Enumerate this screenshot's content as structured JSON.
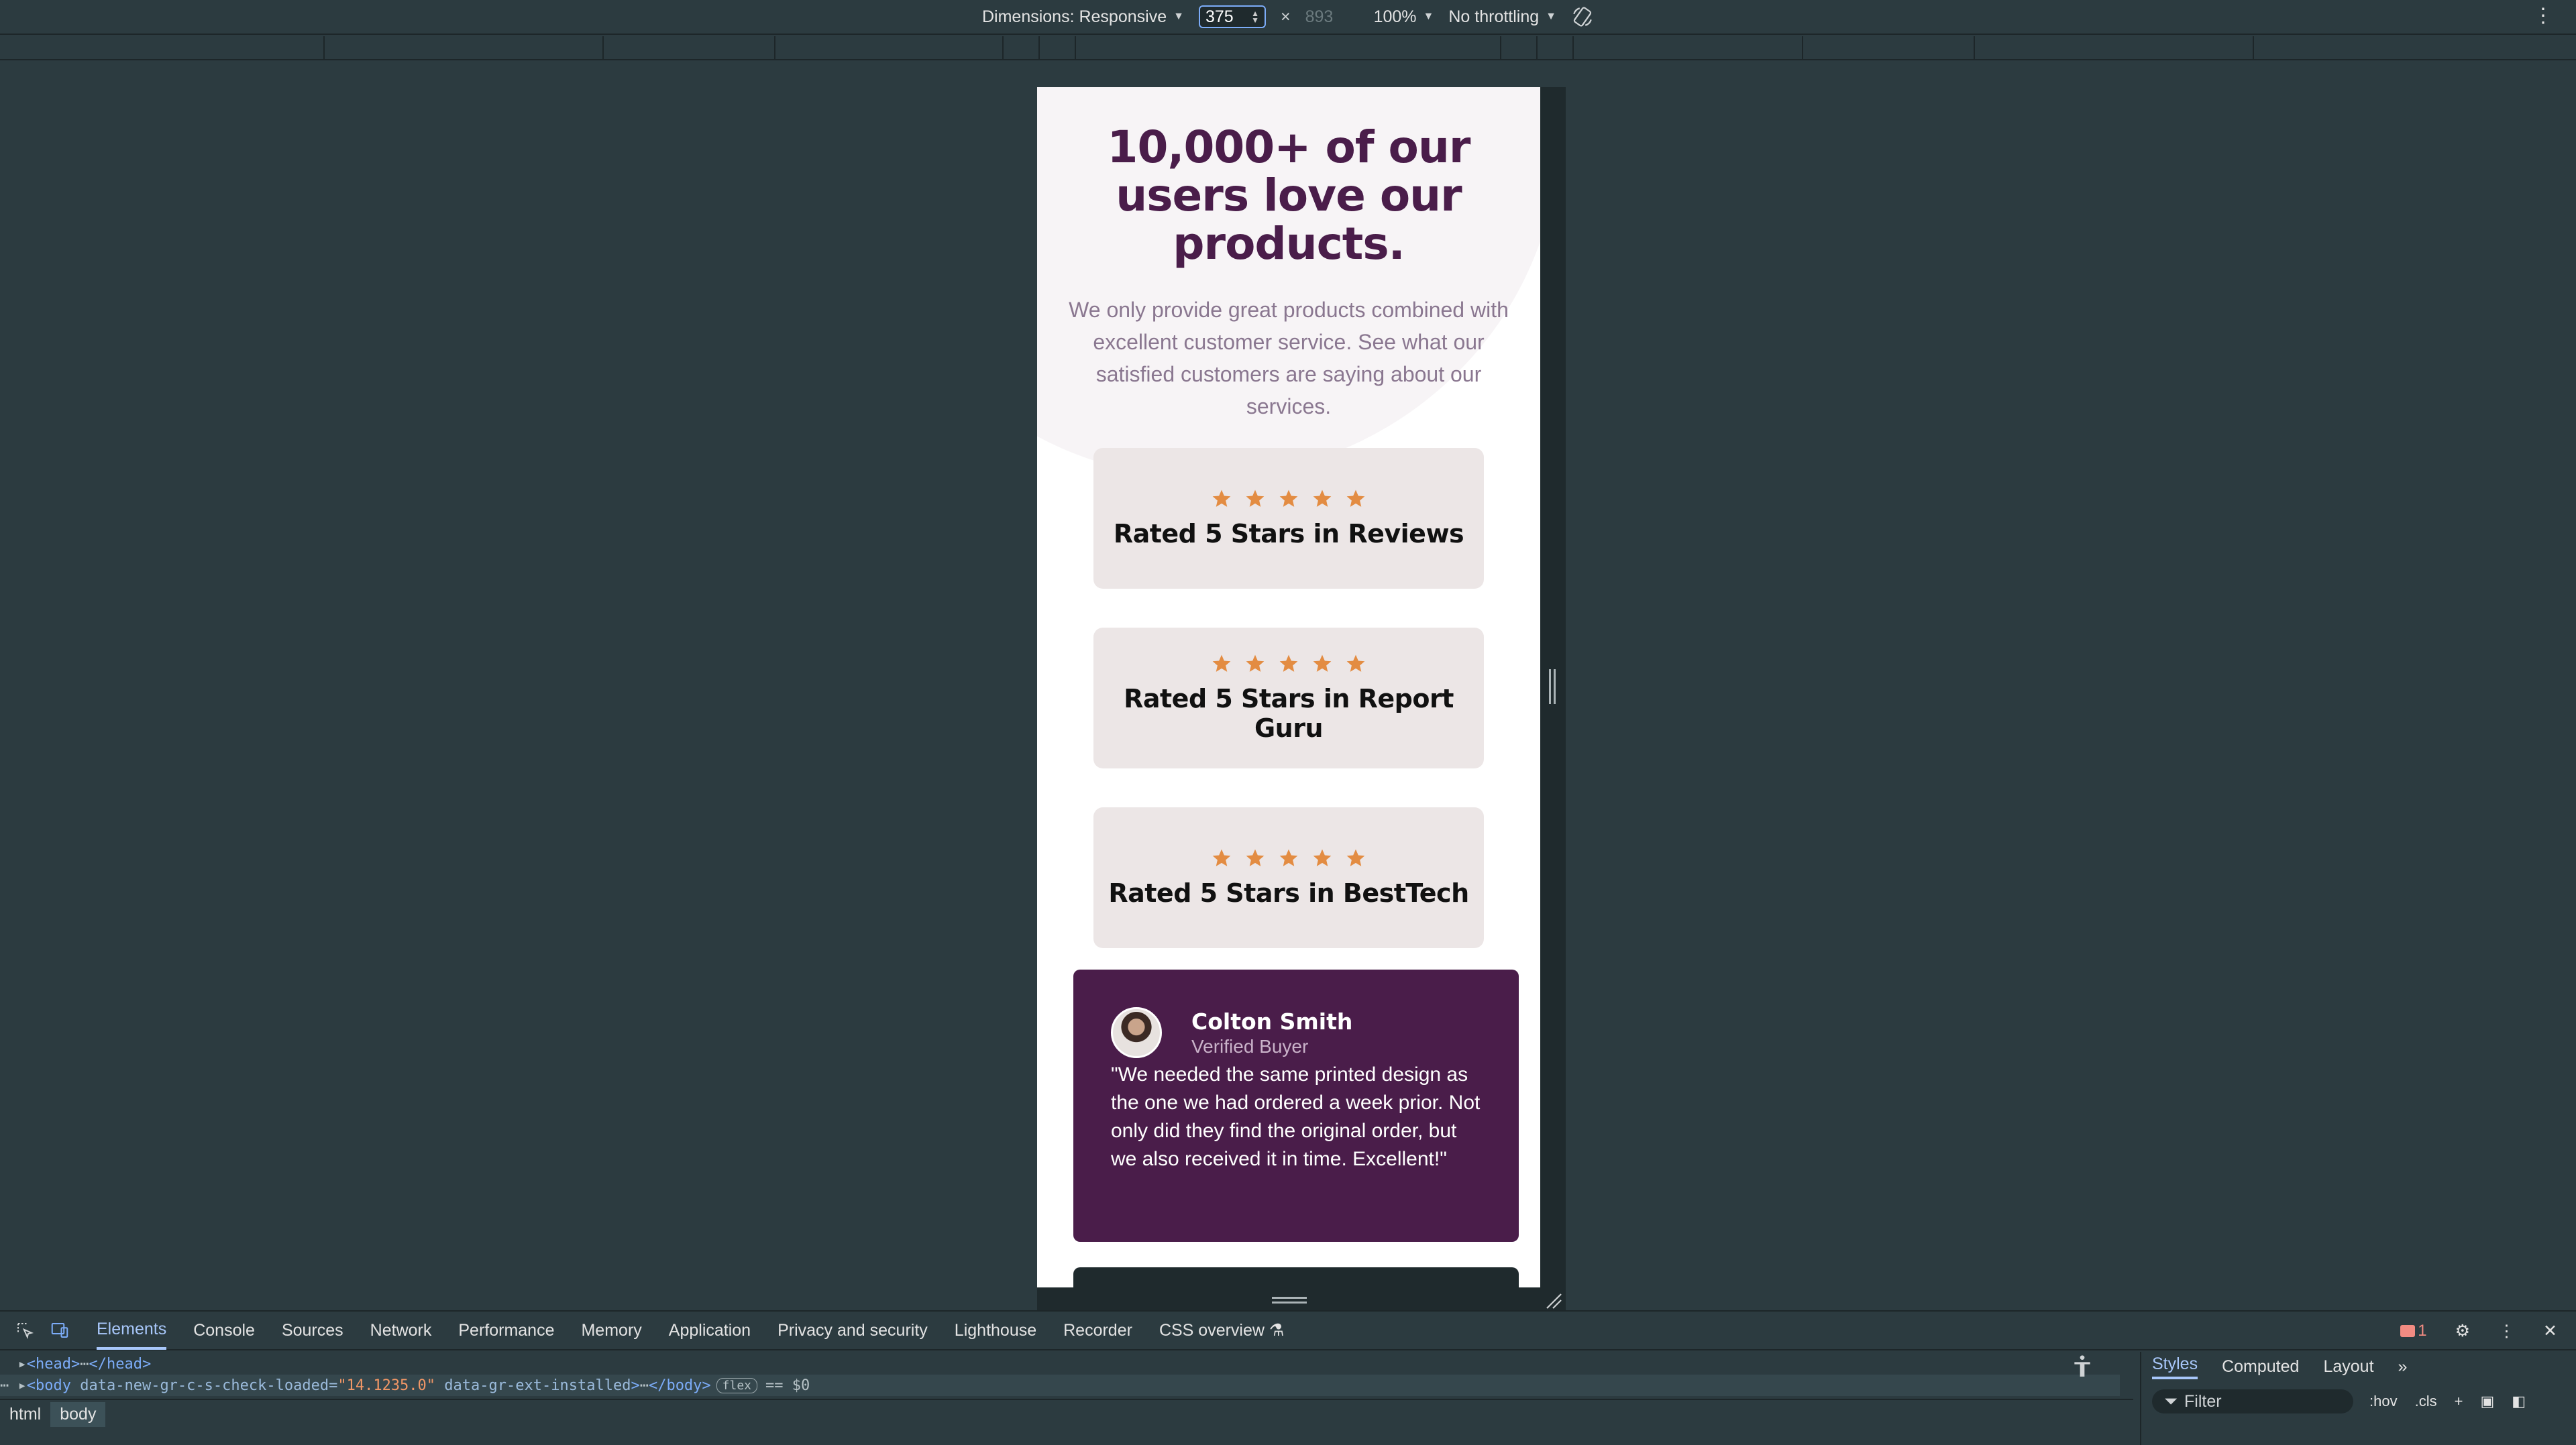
{
  "toolbar": {
    "dimensions_label": "Dimensions: Responsive",
    "width_value": "375",
    "height_value": "893",
    "times": "×",
    "zoom": "100%",
    "throttling": "No throttling"
  },
  "page": {
    "headline": "10,000+ of our users love our products.",
    "intro": "We only provide great products combined with excellent customer service. See what our satisfied customers are saying about our services.",
    "ratings": [
      {
        "label": "Rated 5 Stars in Reviews",
        "stars": 5
      },
      {
        "label": "Rated 5 Stars in Report Guru",
        "stars": 5
      },
      {
        "label": "Rated 5 Stars in BestTech",
        "stars": 5
      }
    ],
    "testimonial": {
      "name": "Colton Smith",
      "role": "Verified Buyer",
      "quote": "\"We needed the same printed design as the one we had ordered a week prior. Not only did they find the original order, but we also received it in time. Excellent!\""
    },
    "colors": {
      "brand": "#4a1d4a",
      "star": "#e38c42",
      "card": "#ece6e6"
    }
  },
  "devtools": {
    "tabs": [
      "Elements",
      "Console",
      "Sources",
      "Network",
      "Performance",
      "Memory",
      "Application",
      "Privacy and security",
      "Lighthouse",
      "Recorder",
      "CSS overview"
    ],
    "active_tab": "Elements",
    "issues_count": "1",
    "dom": {
      "head_line": "<head>",
      "head_close": "</head>",
      "body_open": "<body",
      "body_attr1_name": "data-new-gr-c-s-check-loaded=",
      "body_attr1_val": "\"14.1235.0\"",
      "body_attr2_name": "data-gr-ext-installed",
      "body_close": "</body>",
      "flex_badge": "flex",
      "selected_marker": "== $0"
    },
    "breadcrumbs": [
      "html",
      "body"
    ],
    "styles_tabs": [
      "Styles",
      "Computed",
      "Layout"
    ],
    "filter_placeholder": "Filter",
    "hov": ":hov",
    "cls": ".cls"
  }
}
